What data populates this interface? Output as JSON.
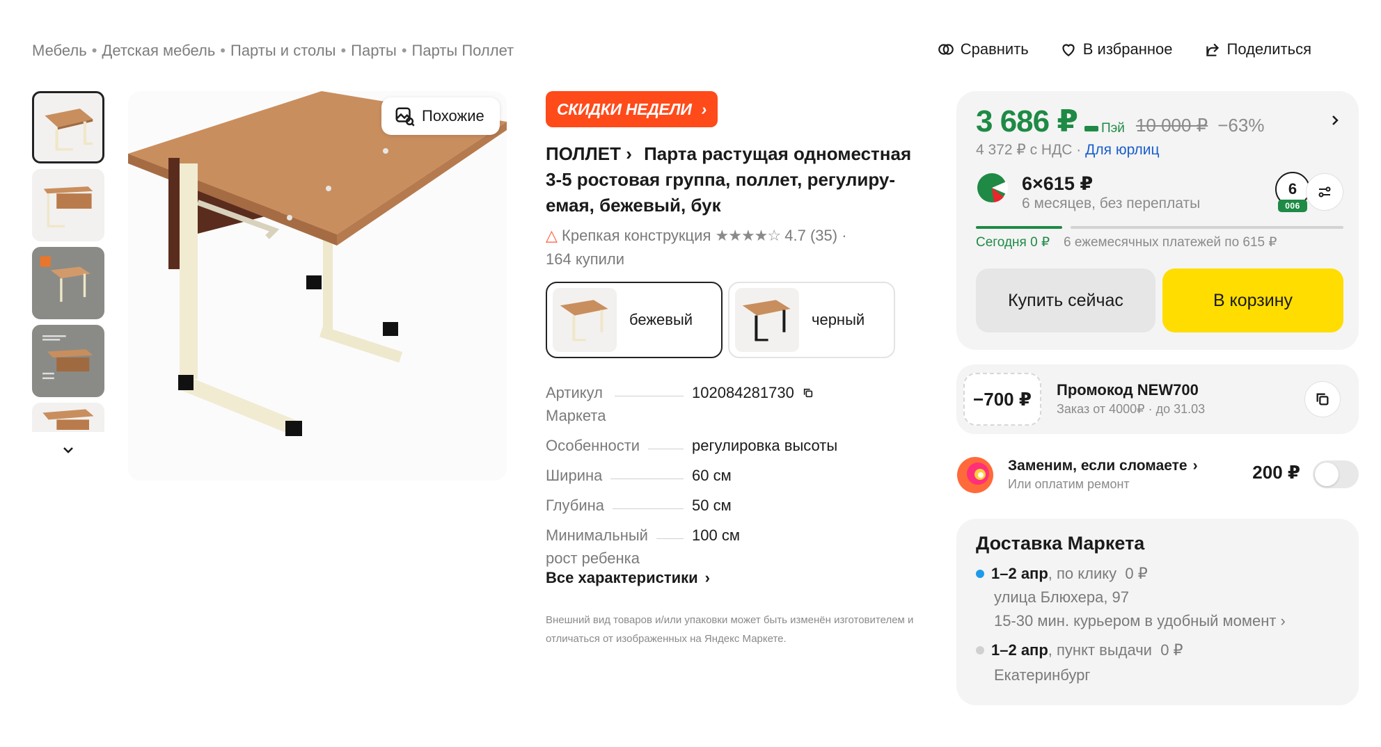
{
  "breadcrumbs": [
    "Мебель",
    "Детская мебель",
    "Парты и столы",
    "Парты",
    "Парты Поллет"
  ],
  "breadcrumb_separator": "•",
  "top_actions": {
    "compare": "Сравнить",
    "favorite": "В избранное",
    "share": "Поделиться"
  },
  "gallery": {
    "thumbnail_count": 5,
    "active_index": 0,
    "similar_label": "Похожие"
  },
  "product": {
    "promo_badge": "СКИДКИ НЕДЕЛИ",
    "brand": "ПОЛЛЕТ",
    "title": "Парта растущая одноместная 3-5 ростовая группа, поллет, регулиру­емая, бежевый, бук",
    "feature": "Крепкая конструкция",
    "stars": "★★★★☆",
    "rating": "4.7",
    "reviews": "(35)",
    "bought": "164 купили",
    "variants": [
      {
        "label": "бежевый",
        "selected": true
      },
      {
        "label": "черный",
        "selected": false
      }
    ],
    "specs": [
      {
        "name": "Артикул Маркета",
        "name_line1": "Артикул",
        "name_line2": "Маркета",
        "value": "102084281730"
      },
      {
        "name": "Особенности",
        "value": "регулировка высоты"
      },
      {
        "name": "Ширина",
        "value": "60 см"
      },
      {
        "name": "Глубина",
        "value": "50 см"
      },
      {
        "name": "Минимальный рост ребенка",
        "name_line1": "Минимальный",
        "name_line2": "рост ребенка",
        "value": "100 см"
      }
    ],
    "all_specs_label": "Все характеристики",
    "disclaimer": "Внешний вид товаров и/или упаковки может быть изменён изготовителем и отличаться от изображенных на Яндекс Маркете."
  },
  "buy_card": {
    "price": "3 686 ₽",
    "pay_label": "Пэй",
    "old_price": "10 000 ₽",
    "discount": "−63%",
    "vat_price": "4 372 ₽ с НДС",
    "vat_dot": " · ",
    "legal_link": "Для юрлиц",
    "split_amount": "6×615 ₽",
    "split_subtitle": "6 месяцев, без переплаты",
    "split_months": "6",
    "split_code": "006",
    "schedule_today": "Сегодня 0 ₽",
    "schedule_rest": "6 ежемесячных платежей по 615 ₽",
    "buy_now": "Купить сейчас",
    "add_to_cart": "В корзину"
  },
  "promo_code": {
    "amount": "−700 ₽",
    "title": "Промокод NEW700",
    "subtitle": "Заказ от 4000₽ · до 31.03"
  },
  "insurance": {
    "title": "Заменим, если сломаете",
    "subtitle": "Или оплатим ремонт",
    "price": "200 ₽",
    "enabled": false
  },
  "delivery": {
    "title": "Доставка Маркета",
    "courier": {
      "date": "1–2 апр",
      "method": ", по клику",
      "price": "0 ₽",
      "address": "улица Блюхера, 97",
      "detail": "15-30 мин. курьером в удобный момент"
    },
    "pickup": {
      "date": "1–2 апр",
      "method": ", пункт выдачи",
      "price": "0 ₽",
      "city": "Екатеринбург"
    }
  },
  "colors": {
    "accent_green": "#1e8a45",
    "cart_yellow": "#ffdd00",
    "promo_orange": "#ff4a1a",
    "link_blue": "#1a5ecc"
  }
}
